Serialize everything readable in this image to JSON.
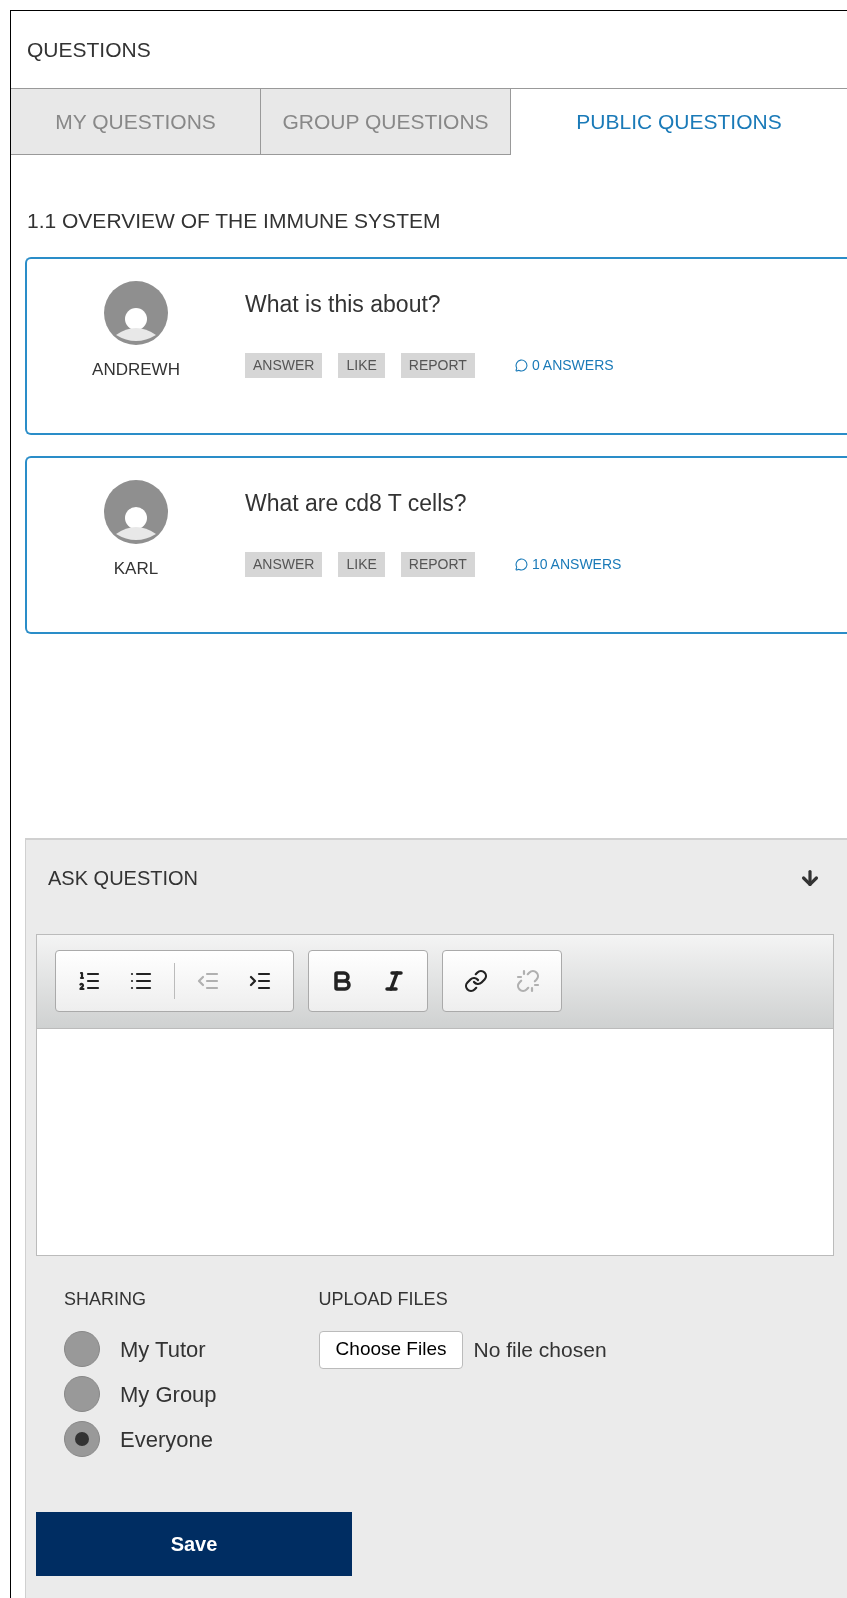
{
  "header": {
    "title": "QUESTIONS"
  },
  "tabs": [
    {
      "label": "MY QUESTIONS",
      "selected": false
    },
    {
      "label": "GROUP QUESTIONS",
      "selected": false
    },
    {
      "label": "PUBLIC QUESTIONS",
      "selected": true
    }
  ],
  "section": {
    "title": "1.1 OVERVIEW OF THE IMMUNE SYSTEM"
  },
  "questions": [
    {
      "author": "ANDREWH",
      "text": "What is this about?",
      "actions": [
        "ANSWER",
        "LIKE",
        "REPORT"
      ],
      "answers": "0 ANSWERS"
    },
    {
      "author": "KARL",
      "text": "What are cd8 T cells?",
      "actions": [
        "ANSWER",
        "LIKE",
        "REPORT"
      ],
      "answers": "10 ANSWERS"
    }
  ],
  "ask_panel": {
    "title": "ASK QUESTION",
    "toolbar": [
      [
        {
          "kind": "numbered-list",
          "disabled": false
        },
        {
          "kind": "bulleted-list",
          "disabled": false
        },
        {
          "kind": "separator"
        },
        {
          "kind": "outdent",
          "disabled": true
        },
        {
          "kind": "indent",
          "disabled": false
        }
      ],
      [
        {
          "kind": "bold",
          "disabled": false
        },
        {
          "kind": "italic",
          "disabled": false
        }
      ],
      [
        {
          "kind": "link",
          "disabled": false
        },
        {
          "kind": "unlink",
          "disabled": true
        }
      ]
    ],
    "sharing": {
      "label": "SHARING",
      "options": [
        {
          "label": "My Tutor",
          "selected": false
        },
        {
          "label": "My Group",
          "selected": false
        },
        {
          "label": "Everyone",
          "selected": true
        }
      ]
    },
    "upload": {
      "label": "UPLOAD FILES",
      "button": "Choose Files",
      "status": "No file chosen"
    },
    "save": "Save"
  }
}
